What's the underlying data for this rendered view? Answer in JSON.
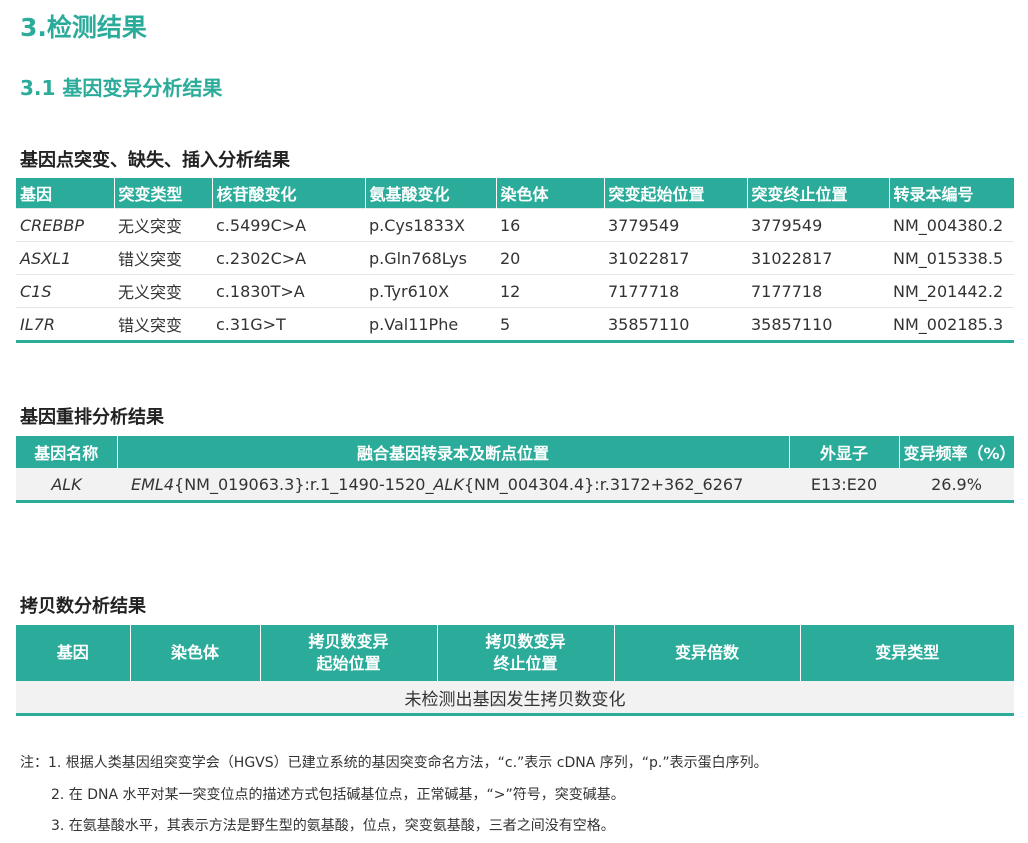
{
  "title": "3.检测结果",
  "subtitle": "3.1 基因变异分析结果",
  "snv": {
    "heading": "基因点突变、缺失、插入分析结果",
    "headers": [
      "基因",
      "突变类型",
      "核苷酸变化",
      "氨基酸变化",
      "染色体",
      "突变起始位置",
      "突变终止位置",
      "转录本编号"
    ],
    "rows": [
      [
        "CREBBP",
        "无义突变",
        "c.5499C>A",
        "p.Cys1833X",
        "16",
        "3779549",
        "3779549",
        "NM_004380.2"
      ],
      [
        "ASXL1",
        "错义突变",
        "c.2302C>A",
        "p.Gln768Lys",
        "20",
        "31022817",
        "31022817",
        "NM_015338.5"
      ],
      [
        "C1S",
        "无义突变",
        "c.1830T>A",
        "p.Tyr610X",
        "12",
        "7177718",
        "7177718",
        "NM_201442.2"
      ],
      [
        "IL7R",
        "错义突变",
        "c.31G>T",
        "p.Val11Phe",
        "5",
        "35857110",
        "35857110",
        "NM_002185.3"
      ]
    ]
  },
  "fusion": {
    "heading": "基因重排分析结果",
    "headers": [
      "基因名称",
      "融合基因转录本及断点位置",
      "外显子",
      "变异频率（%）"
    ],
    "row": {
      "gene": "ALK",
      "g1": "EML4",
      "p1": "{NM_019063.3}:r.1_1490-1520_",
      "g2": "ALK",
      "p2": "{NM_004304.4}:r.3172+362_6267",
      "exon": "E13:E20",
      "freq": "26.9%"
    }
  },
  "cnv": {
    "heading": "拷贝数分析结果",
    "headers": [
      "基因",
      "染色体",
      "拷贝数变异起始位置",
      "拷贝数变异终止位置",
      "变异倍数",
      "变异类型"
    ],
    "headers_line1": [
      "基因",
      "染色体",
      "拷贝数变异",
      "拷贝数变异",
      "变异倍数",
      "变异类型"
    ],
    "headers_line2": [
      "",
      "",
      "起始位置",
      "终止位置",
      "",
      ""
    ],
    "empty_message": "未检测出基因发生拷贝数变化"
  },
  "notes": [
    "注：1. 根据人类基因组突变学会（HGVS）已建立系统的基因突变命名方法，“c.”表示 cDNA 序列，“p.”表示蛋白序列。",
    "2. 在 DNA 水平对某一突变位点的描述方式包括碱基位点，正常碱基，“>”符号，突变碱基。",
    "3. 在氨基酸水平，其表示方法是野生型的氨基酸，位点，突变氨基酸，三者之间没有空格。"
  ],
  "colors": {
    "accent": "#2bab9a"
  }
}
